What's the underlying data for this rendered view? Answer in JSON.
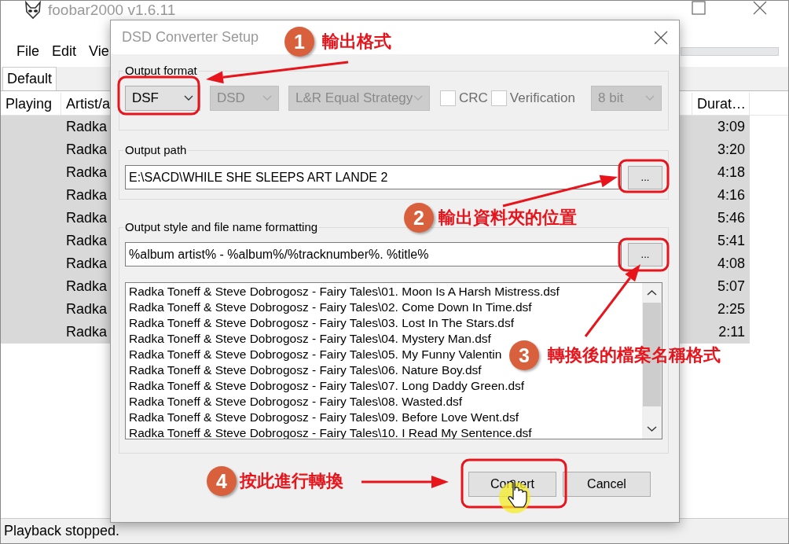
{
  "main_window": {
    "title": "foobar2000 v1.6.11",
    "menu": [
      "File",
      "Edit",
      "Vie"
    ],
    "tabs": [
      {
        "label": "Default",
        "selected": true
      }
    ],
    "columns": [
      "Playing",
      "Artist/a",
      "Durat…"
    ],
    "rows": [
      {
        "artist": "Radka",
        "duration": "3:09"
      },
      {
        "artist": "Radka",
        "duration": "3:20"
      },
      {
        "artist": "Radka",
        "duration": "4:18"
      },
      {
        "artist": "Radka",
        "duration": "4:16"
      },
      {
        "artist": "Radka",
        "duration": "5:46"
      },
      {
        "artist": "Radka",
        "duration": "5:41"
      },
      {
        "artist": "Radka",
        "duration": "4:08"
      },
      {
        "artist": "Radka",
        "duration": "5:07"
      },
      {
        "artist": "Radka",
        "duration": "2:25"
      },
      {
        "artist": "Radka",
        "duration": "2:11"
      }
    ],
    "status_bar": "Playback stopped."
  },
  "dialog": {
    "title": "DSD Converter Setup",
    "output_format": {
      "label": "Output format",
      "controls": [
        {
          "kind": "dropdown",
          "value": "DSF",
          "disabled": false
        },
        {
          "kind": "dropdown",
          "value": "DSD",
          "disabled": true
        },
        {
          "kind": "dropdown",
          "value": "L&R Equal Strategy",
          "disabled": true
        },
        {
          "kind": "checkbox",
          "label": "CRC",
          "checked": false,
          "disabled": true
        },
        {
          "kind": "checkbox",
          "label": "Verification",
          "checked": false,
          "disabled": true
        },
        {
          "kind": "dropdown",
          "value": "8 bit",
          "disabled": true
        }
      ]
    },
    "output_path": {
      "label": "Output path",
      "value": "E:\\SACD\\WHILE SHE SLEEPS ART LANDE 2",
      "button": "..."
    },
    "output_style": {
      "label": "Output style and file name formatting",
      "value": "%album artist% - %album%/%tracknumber%. %title%",
      "button": "...",
      "preview": [
        "Radka Toneff & Steve Dobrogosz - Fairy Tales\\01. Moon Is A Harsh Mistress.dsf",
        "Radka Toneff & Steve Dobrogosz - Fairy Tales\\02. Come Down In Time.dsf",
        "Radka Toneff & Steve Dobrogosz - Fairy Tales\\03. Lost In The Stars.dsf",
        "Radka Toneff & Steve Dobrogosz - Fairy Tales\\04. Mystery Man.dsf",
        "Radka Toneff & Steve Dobrogosz - Fairy Tales\\05. My Funny Valentin",
        "Radka Toneff & Steve Dobrogosz - Fairy Tales\\06. Nature Boy.dsf",
        "Radka Toneff & Steve Dobrogosz - Fairy Tales\\07. Long Daddy Green.dsf",
        "Radka Toneff & Steve Dobrogosz - Fairy Tales\\08. Wasted.dsf",
        "Radka Toneff & Steve Dobrogosz - Fairy Tales\\09. Before Love Went.dsf",
        "Radka Toneff & Steve Dobrogosz - Fairy Tales\\10. I Read My Sentence.dsf"
      ]
    },
    "buttons": [
      "Convert",
      "Cancel"
    ]
  },
  "annotations": [
    {
      "number": "1",
      "text": "輸出格式"
    },
    {
      "number": "2",
      "text": "輸出資料夾的位置"
    },
    {
      "number": "3",
      "text": "轉換後的檔案名稱格式"
    },
    {
      "number": "4",
      "text": "按此進行轉換"
    }
  ]
}
